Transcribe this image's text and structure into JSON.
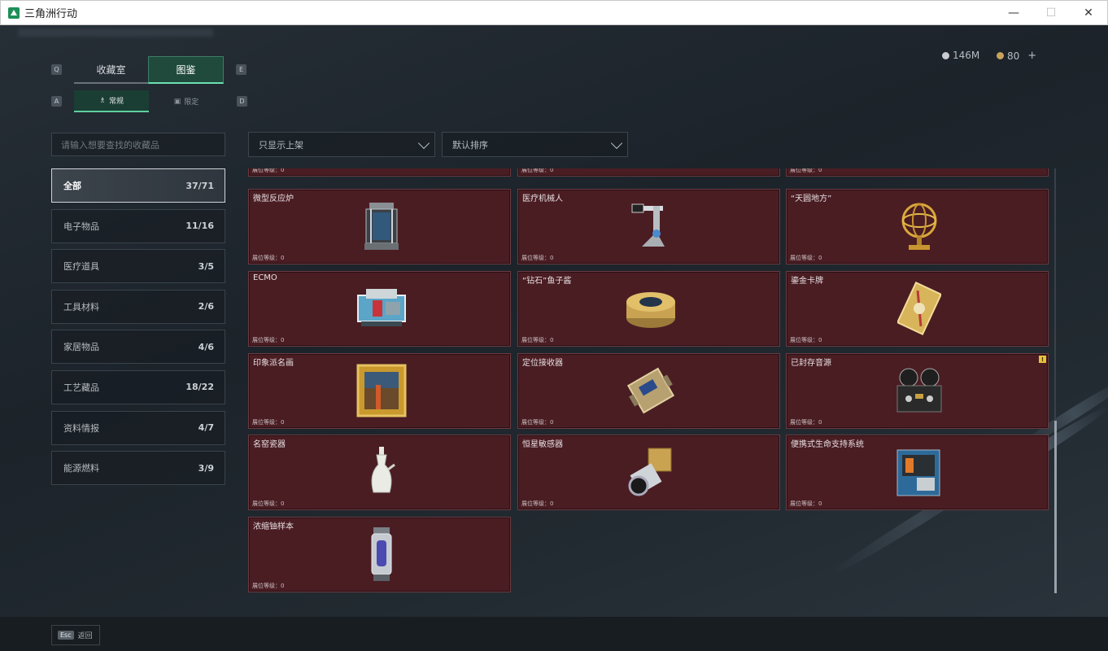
{
  "window": {
    "title": "三角洲行动",
    "minimize": "—",
    "maximize": "☐",
    "close": "✕"
  },
  "currency": {
    "money": "146M",
    "coins": "80",
    "add": "+"
  },
  "keys": {
    "prev_tab": "Q",
    "next_tab": "E",
    "prev_sub": "A",
    "next_sub": "D"
  },
  "tabs": [
    {
      "label": "收藏室"
    },
    {
      "label": "图鉴"
    }
  ],
  "subtabs": [
    {
      "label": "常规"
    },
    {
      "label": "限定"
    }
  ],
  "search": {
    "placeholder": "请输入想要查找的收藏品"
  },
  "filters": {
    "display": "只显示上架",
    "sort": "默认排序"
  },
  "categories": [
    {
      "label": "全部",
      "count": "37/71"
    },
    {
      "label": "电子物品",
      "count": "11/16"
    },
    {
      "label": "医疗道具",
      "count": "3/5"
    },
    {
      "label": "工具材料",
      "count": "2/6"
    },
    {
      "label": "家居物品",
      "count": "4/6"
    },
    {
      "label": "工艺藏品",
      "count": "18/22"
    },
    {
      "label": "资料情报",
      "count": "4/7"
    },
    {
      "label": "能源燃料",
      "count": "3/9"
    }
  ],
  "level_label": "展位等级：0",
  "items": [
    {
      "name": "",
      "icon": "partial-item-icon"
    },
    {
      "name": "",
      "icon": "partial-item-icon"
    },
    {
      "name": "",
      "icon": "partial-item-icon"
    },
    {
      "name": "微型反应炉",
      "icon": "reactor-icon"
    },
    {
      "name": "医疗机械人",
      "icon": "medical-robot-icon"
    },
    {
      "name": "“天圆地方”",
      "icon": "armillary-sphere-icon"
    },
    {
      "name": "ECMO",
      "icon": "ecmo-machine-icon"
    },
    {
      "name": "“钻石”鱼子酱",
      "icon": "caviar-tin-icon"
    },
    {
      "name": "鎏金卡牌",
      "icon": "gilded-card-icon"
    },
    {
      "name": "印象派名画",
      "icon": "framed-painting-icon"
    },
    {
      "name": "定位接收器",
      "icon": "gps-receiver-icon"
    },
    {
      "name": "已封存音源",
      "icon": "tape-recorder-icon",
      "alert": "!"
    },
    {
      "name": "名窑瓷器",
      "icon": "porcelain-vase-icon"
    },
    {
      "name": "恒星敏感器",
      "icon": "star-sensor-icon"
    },
    {
      "name": "便携式生命支持系统",
      "icon": "life-support-icon"
    },
    {
      "name": "浓缩铀样本",
      "icon": "uranium-sample-icon"
    }
  ],
  "footer": {
    "key": "Esc",
    "label": "返回"
  },
  "colors": {
    "accent": "#5fcf9f",
    "card_bg": "#4a1d23",
    "panel_bg": "#1c232a"
  }
}
